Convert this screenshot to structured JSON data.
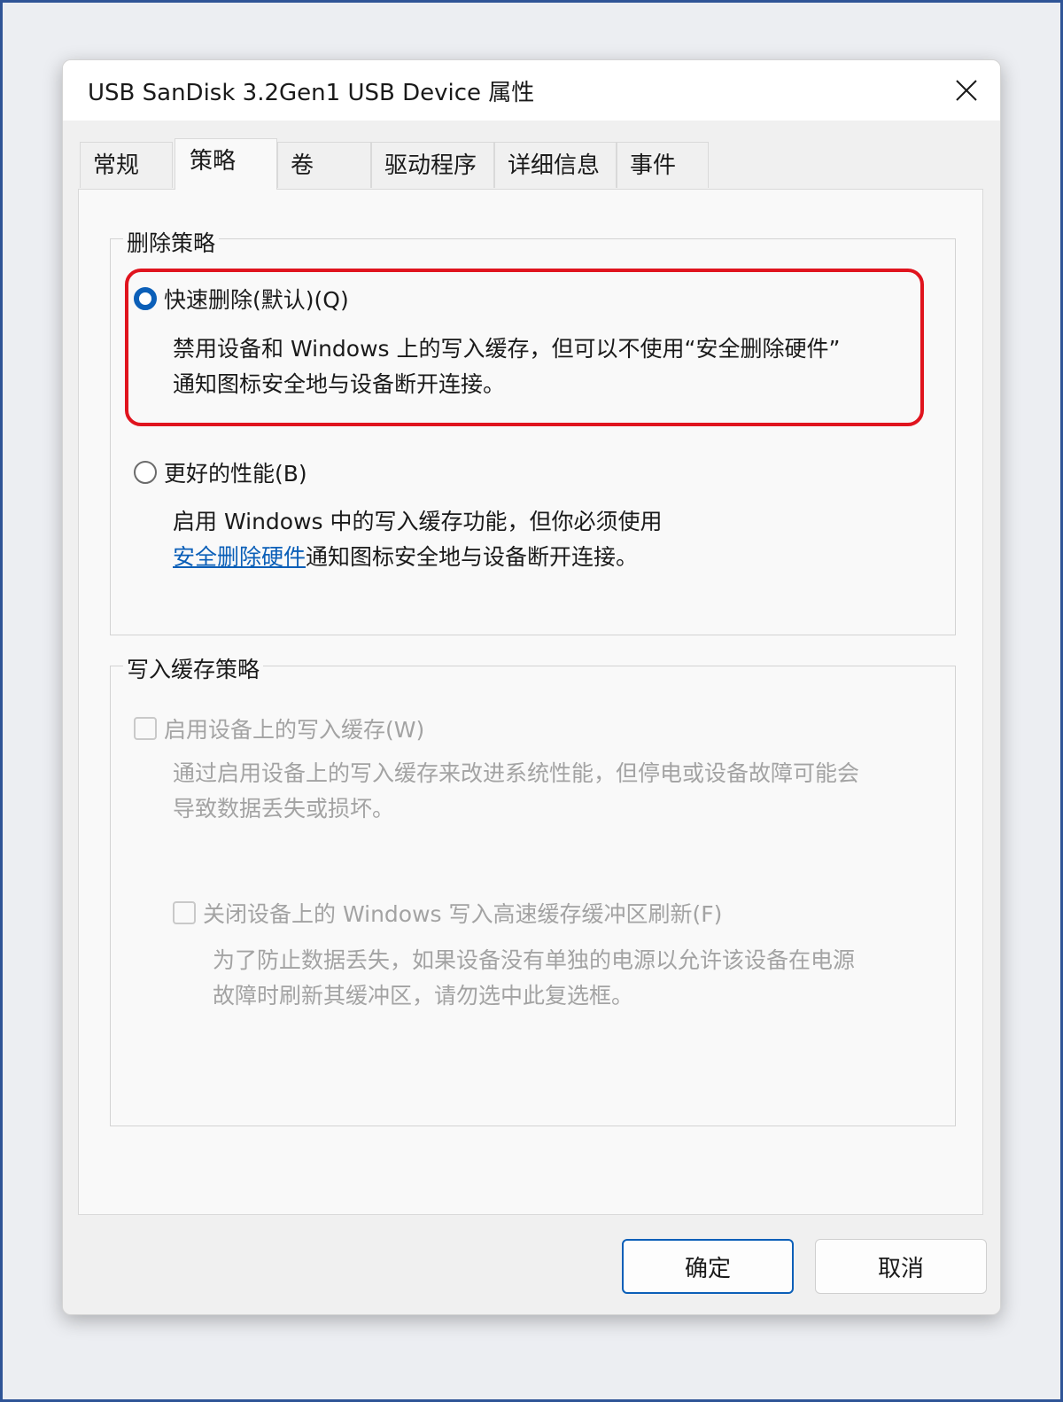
{
  "window": {
    "title": "USB  SanDisk 3.2Gen1 USB Device 属性"
  },
  "tabs": [
    {
      "label": "常规"
    },
    {
      "label": "策略"
    },
    {
      "label": "卷"
    },
    {
      "label": "驱动程序"
    },
    {
      "label": "详细信息"
    },
    {
      "label": "事件"
    }
  ],
  "removal_policy": {
    "legend": "删除策略",
    "quick_removal": {
      "label": "快速删除(默认)(Q)",
      "desc_line1": "禁用设备和 Windows 上的写入缓存，但可以不使用“安全删除硬件”",
      "desc_line2": "通知图标安全地与设备断开连接。",
      "checked": true
    },
    "better_performance": {
      "label": "更好的性能(B)",
      "desc_line1": "启用 Windows 中的写入缓存功能，但你必须使用",
      "link": "安全删除硬件",
      "desc_line2_rest": "通知图标安全地与设备断开连接。",
      "checked": false
    }
  },
  "write_cache_policy": {
    "legend": "写入缓存策略",
    "enable_cache": {
      "label": "启用设备上的写入缓存(W)",
      "desc_line1": "通过启用设备上的写入缓存来改进系统性能，但停电或设备故障可能会",
      "desc_line2": "导致数据丢失或损坏。",
      "checked": false
    },
    "turn_off_flush": {
      "label": "关闭设备上的 Windows 写入高速缓存缓冲区刷新(F)",
      "desc_line1": "为了防止数据丢失，如果设备没有单独的电源以允许该设备在电源",
      "desc_line2": "故障时刷新其缓冲区，请勿选中此复选框。",
      "checked": false
    }
  },
  "buttons": {
    "ok": "确定",
    "cancel": "取消"
  },
  "colors": {
    "accent": "#0b5fb8",
    "highlight": "#e0141e",
    "frame": "#2f5496",
    "disabled_text": "#a3a3a3"
  },
  "icons": {
    "close": "close-icon"
  }
}
